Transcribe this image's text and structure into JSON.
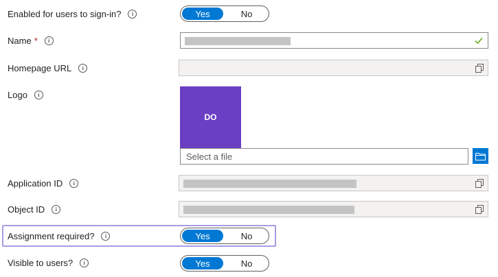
{
  "enabled": {
    "label": "Enabled for users to sign-in?",
    "yes": "Yes",
    "no": "No",
    "value": "Yes"
  },
  "name": {
    "label": "Name",
    "required_mark": "*"
  },
  "homepage": {
    "label": "Homepage URL"
  },
  "logo": {
    "label": "Logo",
    "initials": "DO",
    "file_placeholder": "Select a file"
  },
  "application_id": {
    "label": "Application ID"
  },
  "object_id": {
    "label": "Object ID"
  },
  "assignment": {
    "label": "Assignment required?",
    "yes": "Yes",
    "no": "No",
    "value": "Yes"
  },
  "visible": {
    "label": "Visible to users?",
    "yes": "Yes",
    "no": "No",
    "value": "Yes"
  },
  "icons": {
    "info": "info-icon",
    "copy": "copy-icon",
    "check": "checkmark-icon",
    "folder": "folder-icon"
  },
  "colors": {
    "accent": "#0078d4",
    "logo_bg": "#6b3fc4",
    "highlight": "#a99ae6",
    "valid": "#57a300"
  }
}
